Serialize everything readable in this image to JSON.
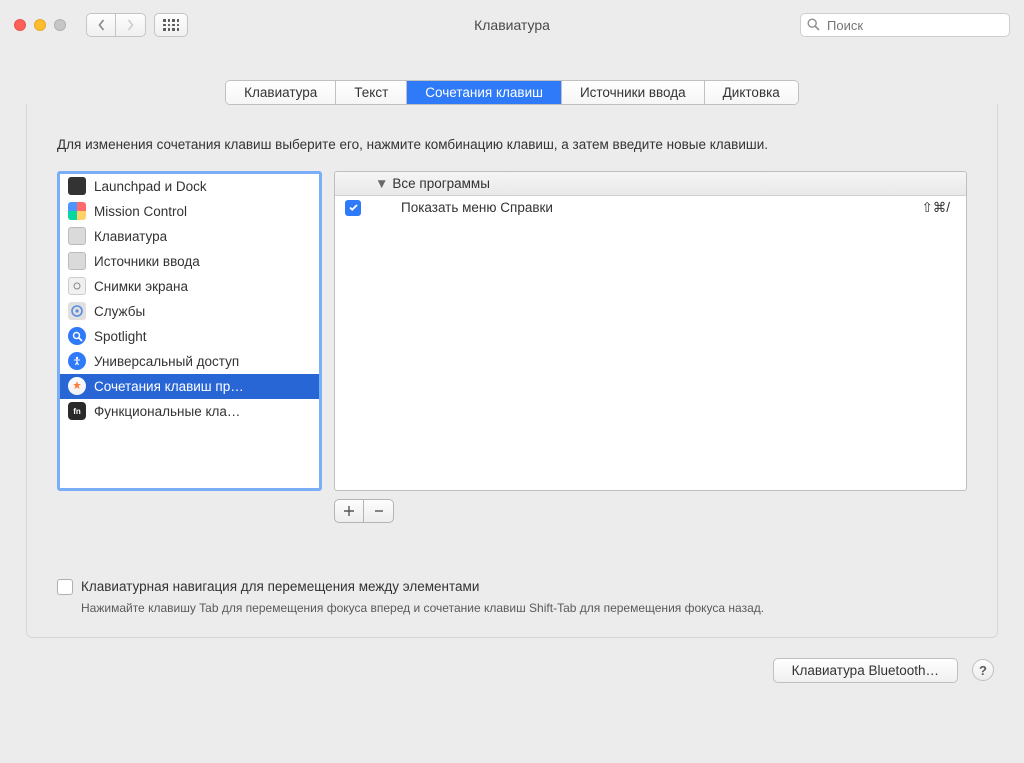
{
  "title": "Клавиатура",
  "search": {
    "placeholder": "Поиск"
  },
  "tabs": {
    "keyboard": "Клавиатура",
    "text": "Текст",
    "shortcuts": "Сочетания клавиш",
    "input_sources": "Источники ввода",
    "dictation": "Диктовка"
  },
  "instruction": "Для изменения сочетания клавиш выберите его, нажмите комбинацию клавиш, а затем введите новые клавиши.",
  "sidebar": [
    {
      "label": "Launchpad и Dock"
    },
    {
      "label": "Mission Control"
    },
    {
      "label": "Клавиатура"
    },
    {
      "label": "Источники ввода"
    },
    {
      "label": "Снимки экрана"
    },
    {
      "label": "Службы"
    },
    {
      "label": "Spotlight"
    },
    {
      "label": "Универсальный доступ"
    },
    {
      "label": "Сочетания клавиш пр…"
    },
    {
      "label": "Функциональные кла…"
    }
  ],
  "group_header": "Все программы",
  "shortcuts": [
    {
      "enabled": true,
      "label": "Показать меню Справки",
      "combo": "⇧⌘/"
    }
  ],
  "plus": "＋",
  "minus": "－",
  "bottom_checkbox_label": "Клавиатурная навигация для перемещения между элементами",
  "bottom_desc": "Нажимайте клавишу Tab для перемещения фокуса вперед и сочетание клавиш Shift-Tab для перемещения фокуса назад.",
  "footer_btn": "Клавиатура Bluetooth…",
  "help": "?"
}
